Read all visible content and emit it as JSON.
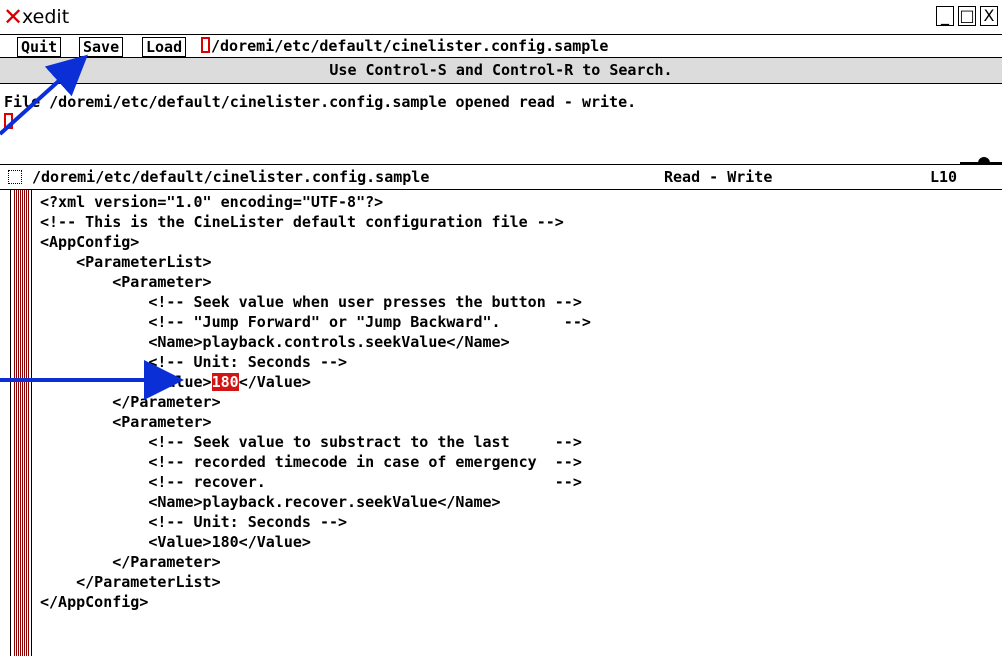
{
  "window": {
    "title": "xedit",
    "minimize_glyph": "_",
    "maximize_glyph": "□",
    "close_glyph": "X"
  },
  "commands": {
    "quit_label": "Quit",
    "save_label": "Save",
    "load_label": "Load",
    "file_path": "/doremi/etc/default/cinelister.config.sample"
  },
  "info": {
    "label": "Use Control-S and Control-R to Search."
  },
  "messages": {
    "line1": "File /doremi/etc/default/cinelister.config.sample opened read - write."
  },
  "status": {
    "file_path": "/doremi/etc/default/cinelister.config.sample",
    "mode": "Read - Write",
    "line": "L10"
  },
  "editor": {
    "lines": [
      "<?xml version=\"1.0\" encoding=\"UTF-8\"?>",
      "<!-- This is the CineLister default configuration file -->",
      "<AppConfig>",
      "    <ParameterList>",
      "        <Parameter>",
      "            <!-- Seek value when user presses the button -->",
      "            <!-- \"Jump Forward\" or \"Jump Backward\".       -->",
      "            <Name>playback.controls.seekValue</Name>",
      "            <!-- Unit: Seconds -->",
      "            <Value>",
      "        </Parameter>",
      "        <Parameter>",
      "            <!-- Seek value to substract to the last     -->",
      "            <!-- recorded timecode in case of emergency  -->",
      "            <!-- recover.                                -->",
      "            <Name>playback.recover.seekValue</Name>",
      "            <!-- Unit: Seconds -->",
      "            <Value>180</Value>",
      "        </Parameter>",
      "    </ParameterList>",
      "</AppConfig>"
    ],
    "highlight_value": "180",
    "value_close": "</Value>"
  },
  "colors": {
    "scrollbar": "#8b0000",
    "cursor": "#dd0000",
    "arrow": "#0b2fd6",
    "info_bg": "#dcdcdc"
  }
}
